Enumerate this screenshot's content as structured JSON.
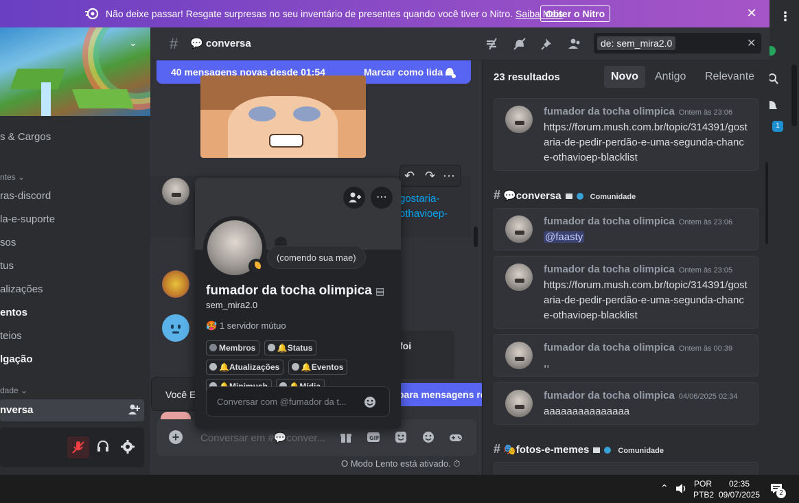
{
  "banner": {
    "message": "Não deixe passar! Resgate surpresas no seu inventário de presentes quando você tiver o Nitro.",
    "link": "Saiba Mais",
    "button": "Obter o Nitro",
    "accent": "#8a4bc5"
  },
  "sidebar": {
    "items": [
      {
        "label": "s & Cargos",
        "bold": false
      },
      {
        "label": "ntes",
        "category": true
      },
      {
        "label": "ras-discord",
        "bold": false
      },
      {
        "label": "la-e-suporte",
        "bold": false
      },
      {
        "label": "sos",
        "bold": false
      },
      {
        "label": "tus",
        "bold": false
      },
      {
        "label": "alizações",
        "bold": false
      },
      {
        "label": "entos",
        "bold": true
      },
      {
        "label": "teios",
        "bold": false
      },
      {
        "label": "lgação",
        "bold": true
      },
      {
        "label": "dade",
        "category": true
      }
    ],
    "active": "nversa"
  },
  "header": {
    "channel": "conversa",
    "search_token": "de:  sem_mira2.0"
  },
  "new_messages": {
    "text": "40 mensagens novas desde 01:54",
    "action": "Marcar como lida"
  },
  "chat": {
    "partial_link_1": "gostaria-",
    "partial_link_2": "othavioep-",
    "partial_text": "!",
    "embed_title": "foi",
    "typing": "Você Es",
    "jump": "para mensagens rec",
    "composer_placeholder": "Conversar em #💬conver...",
    "slow_mode": "O Modo Lento está ativado."
  },
  "profile": {
    "status": "(comendo sua mae)",
    "display_name": "fumador da tocha olimpica",
    "username": "sem_mira2.0",
    "mutual": "1 servidor mútuo",
    "roles": [
      "Membros",
      "🔔Status",
      "🔔Atualizações",
      "🔔Eventos",
      "🔔Minimush",
      "🔔Mídia"
    ],
    "dm_placeholder": "Conversar com @fumador da t..."
  },
  "results": {
    "count": "23 resultados",
    "sort": [
      "Novo",
      "Antigo",
      "Relevante"
    ],
    "cards": [
      {
        "author": "fumador da tocha olimpica",
        "time": "Ontem às 23:06",
        "body": "https://forum.mush.com.br/topic/314391/gostaria-de-pedir-perdão-e-uma-segunda-chance-othavioep-blacklist",
        "link": true
      },
      {
        "author": "fumador da tocha olimpica",
        "time": "Ontem às 23:06",
        "body": "@faasty",
        "mention": true
      },
      {
        "author": "fumador da tocha olimpica",
        "time": "Ontem às 23:05",
        "body": "https://forum.mush.com.br/topic/314391/gostaria-de-pedir-perdão-e-uma-segunda-chance-othavioep-blacklist",
        "link": true
      },
      {
        "author": "fumador da tocha olimpica",
        "time": "Ontem às 00:39",
        "body": ",,"
      },
      {
        "author": "fumador da tocha olimpica",
        "time": "04/06/2025 02:34",
        "body": "aaaaaaaaaaaaaaa"
      }
    ],
    "channel_headers": [
      {
        "name": "💬conversa",
        "tag": "Comunidade"
      },
      {
        "name": "🎭fotos-e-memes",
        "tag": "Comunidade"
      }
    ]
  },
  "taskbar": {
    "lang": "POR",
    "layout": "PTB2",
    "time": "02:35",
    "date": "09/07/2025",
    "notif_count": "2",
    "badge": "1"
  }
}
